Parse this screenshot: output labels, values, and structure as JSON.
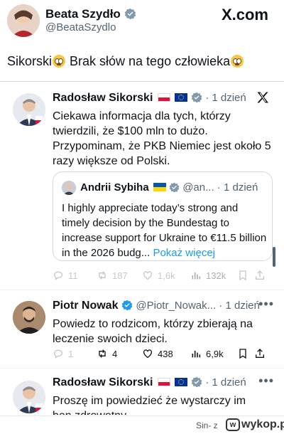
{
  "outer": {
    "name": "Beata Szydło",
    "handle": "@BeataSzydlo",
    "brand": "X.com",
    "text_before": "Sikorski",
    "text_after": " Brak słów na tego człowieka"
  },
  "tweet1": {
    "name": "Radosław Sikorski",
    "time": "1 dzień",
    "text": "Ciekawa informacja dla tych, którzy twierdzili, że $100 mln to dużo. Przypominam, że PKB Niemiec jest około 5 razy większe od Polski."
  },
  "quote": {
    "name": "Andrii Sybiha",
    "handle": "@an...",
    "time": "1 dzień",
    "text": "I highly appreciate today’s strong and timely decision by the Bundestag to increase support for Ukraine to €11.5 billion in the 2026 budg...",
    "more": "Pokaż więcej"
  },
  "actions1": {
    "replies": "11",
    "reposts": "187",
    "likes": "1,6k",
    "views": "132k"
  },
  "tweet2": {
    "name": "Piotr Nowak",
    "handle": "@Piotr_Nowak...",
    "time": "1 dzień",
    "text": "Powiedz to rodzicom, którzy zbierają na leczenie swoich dzieci."
  },
  "actions2": {
    "replies": "1",
    "reposts": "4",
    "likes": "438",
    "views": "6,9k"
  },
  "tweet3": {
    "name": "Radosław Sikorski",
    "time": "1 dzień",
    "text": "Proszę im powiedzieć że wystarczy im bon zdrowotny."
  },
  "footer": {
    "source": "Sin- z",
    "site": "wykop.pl"
  },
  "colors": {
    "verified": "#1d9bf0",
    "link": "#1d9bf0",
    "muted": "#536471",
    "gold_verified": "#e2b719"
  }
}
